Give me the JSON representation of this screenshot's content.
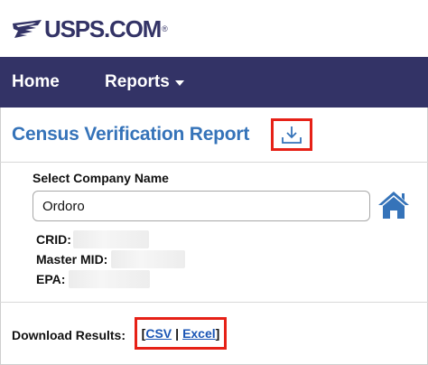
{
  "brand": {
    "logo_text": "USPS.COM",
    "trademark": "®"
  },
  "nav": {
    "home_label": "Home",
    "reports_label": "Reports"
  },
  "page": {
    "title": "Census Verification Report"
  },
  "form": {
    "company_label": "Select Company Name",
    "company_value": "Ordoro",
    "crid_label": "CRID:",
    "master_mid_label": "Master MID:",
    "epa_label": "EPA:"
  },
  "download": {
    "label": "Download Results:",
    "bracket_open": "[",
    "csv_label": "CSV",
    "separator": "|",
    "excel_label": "Excel",
    "bracket_close": "]"
  },
  "colors": {
    "brand_navy": "#333366",
    "title_blue": "#3573b9",
    "link_blue": "#1a55b5",
    "highlight_red": "#e62117"
  },
  "icons": {
    "download": "download-icon",
    "home": "home-icon",
    "eagle": "usps-eagle-icon",
    "caret": "caret-down-icon"
  }
}
